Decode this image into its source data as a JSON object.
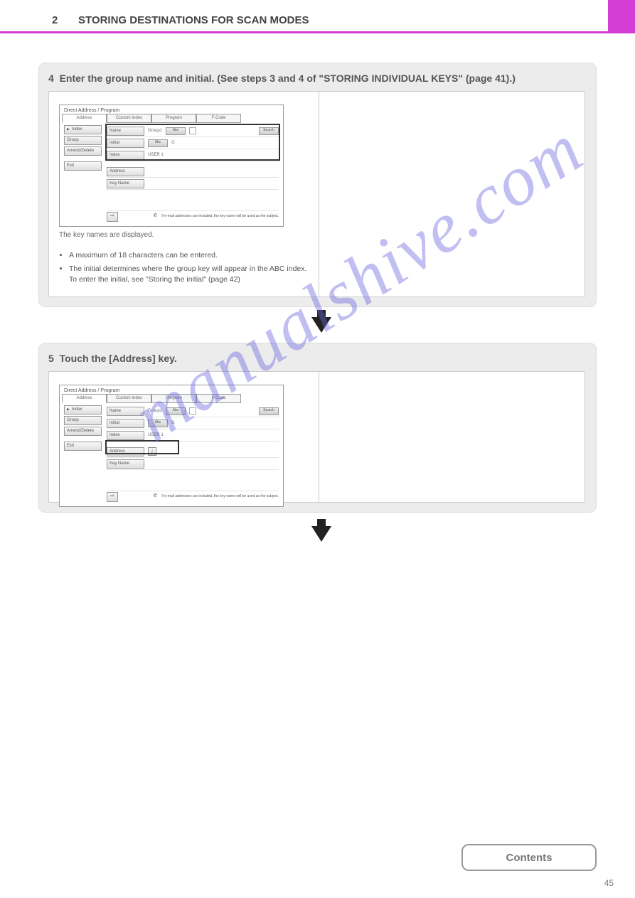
{
  "header": {
    "section_number": "2",
    "section_title": "STORING DESTINATIONS FOR SCAN MODES"
  },
  "card4": {
    "title": "Enter the group name and initial. (See steps 3 and 4 of \"STORING INDIVIDUAL KEYS\" (page 41).)",
    "step_ref": "4",
    "notes": [
      "A maximum of 18 characters can be entered.",
      "The initial determines where the group key will appear in the ABC index. To enter the initial, see \"Storing the initial\" (page 42)"
    ]
  },
  "card5": {
    "title": "Touch the [Address] key.",
    "step_ref": "5"
  },
  "screen": {
    "title_bar": "Direct Address / Program",
    "tabs": [
      "Address",
      "Custom Index",
      "Program",
      "F-Code"
    ],
    "side_buttons": [
      "Index",
      "Group",
      "Amend/Delete",
      "Exit"
    ],
    "rows": [
      {
        "label": "Name",
        "btn1": "Abc",
        "btn2": "Search",
        "value": "Group1"
      },
      {
        "label": "Initial",
        "btn": "Abc",
        "value": "G"
      },
      {
        "label": "Index",
        "value": "USER 1"
      },
      {
        "label": "Address",
        "value": ""
      },
      {
        "label": "Key Name",
        "value": ""
      }
    ],
    "footer_note": "If e-mail addresses are included, the key name will be used as the subject."
  },
  "arrow": "↓",
  "watermark": "manualshive.com",
  "footer": {
    "contents": "Contents",
    "page": "45"
  }
}
